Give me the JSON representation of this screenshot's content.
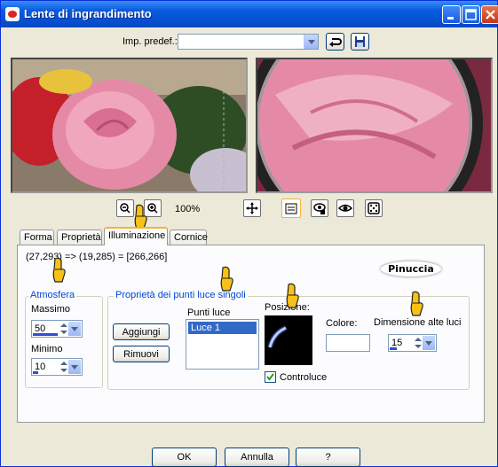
{
  "window": {
    "title": "Lente di ingrandimento"
  },
  "preset": {
    "label": "Imp. predef.:",
    "value": ""
  },
  "zoom": {
    "value": "100%"
  },
  "tabs": [
    {
      "label": "Forma"
    },
    {
      "label": "Proprietà"
    },
    {
      "label": "Illuminazione"
    },
    {
      "label": "Cornice"
    }
  ],
  "coords": "(27,293) => (19,285) = [266,266]",
  "logo_text": "Pinuccia",
  "atmosfera": {
    "title": "Atmosfera",
    "massimo_label": "Massimo",
    "massimo_value": "50",
    "massimo_fill": 0.5,
    "minimo_label": "Minimo",
    "minimo_value": "10",
    "minimo_fill": 0.1
  },
  "proprieta": {
    "title": "Proprietà dei punti luce singoli",
    "aggiungi": "Aggiungi",
    "rimuovi": "Rimuovi",
    "punti_label": "Punti luce",
    "punti_items": [
      "Luce 1"
    ],
    "posizione_label": "Posizione:",
    "colore_label": "Colore:",
    "dimensione_label": "Dimensione alte luci",
    "dimensione_value": "15",
    "dimensione_fill": 0.15,
    "controluce_label": "Controluce",
    "controluce_checked": true
  },
  "buttons": {
    "ok": "OK",
    "annulla": "Annulla",
    "help": "?"
  }
}
